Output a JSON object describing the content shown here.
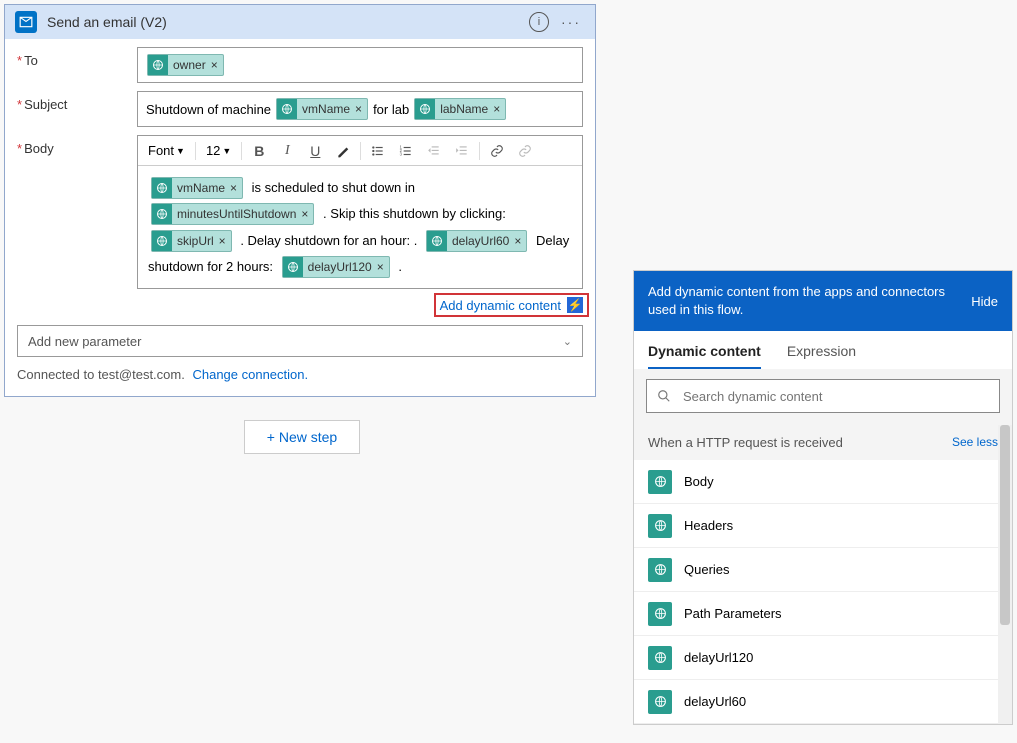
{
  "header": {
    "title": "Send an email (V2)"
  },
  "labels": {
    "to": "To",
    "subject": "Subject",
    "body": "Body"
  },
  "tokens": {
    "owner": "owner",
    "vmName": "vmName",
    "labName": "labName",
    "minutesUntilShutdown": "minutesUntilShutdown",
    "skipUrl": "skipUrl",
    "delayUrl60": "delayUrl60",
    "delayUrl120": "delayUrl120"
  },
  "subjectText": {
    "prefix": "Shutdown of machine",
    "mid": "for lab"
  },
  "bodyText": {
    "t1": "is scheduled to shut down in",
    "t2": ". Skip this shutdown by clicking:",
    "t3": ". Delay shutdown for an hour: .",
    "t4": "Delay shutdown for 2 hours:",
    "t5": "."
  },
  "toolbar": {
    "font": "Font",
    "size": "12"
  },
  "dynamicLink": "Add dynamic content",
  "paramSelect": "Add new parameter",
  "footer": {
    "text": "Connected to test@test.com.",
    "link": "Change connection."
  },
  "newStep": "+ New step",
  "panel": {
    "header": "Add dynamic content from the apps and connectors used in this flow.",
    "hide": "Hide",
    "tabs": {
      "dynamic": "Dynamic content",
      "expression": "Expression"
    },
    "searchPlaceholder": "Search dynamic content",
    "groupTitle": "When a HTTP request is received",
    "seeLess": "See less",
    "items": [
      "Body",
      "Headers",
      "Queries",
      "Path Parameters",
      "delayUrl120",
      "delayUrl60"
    ]
  }
}
